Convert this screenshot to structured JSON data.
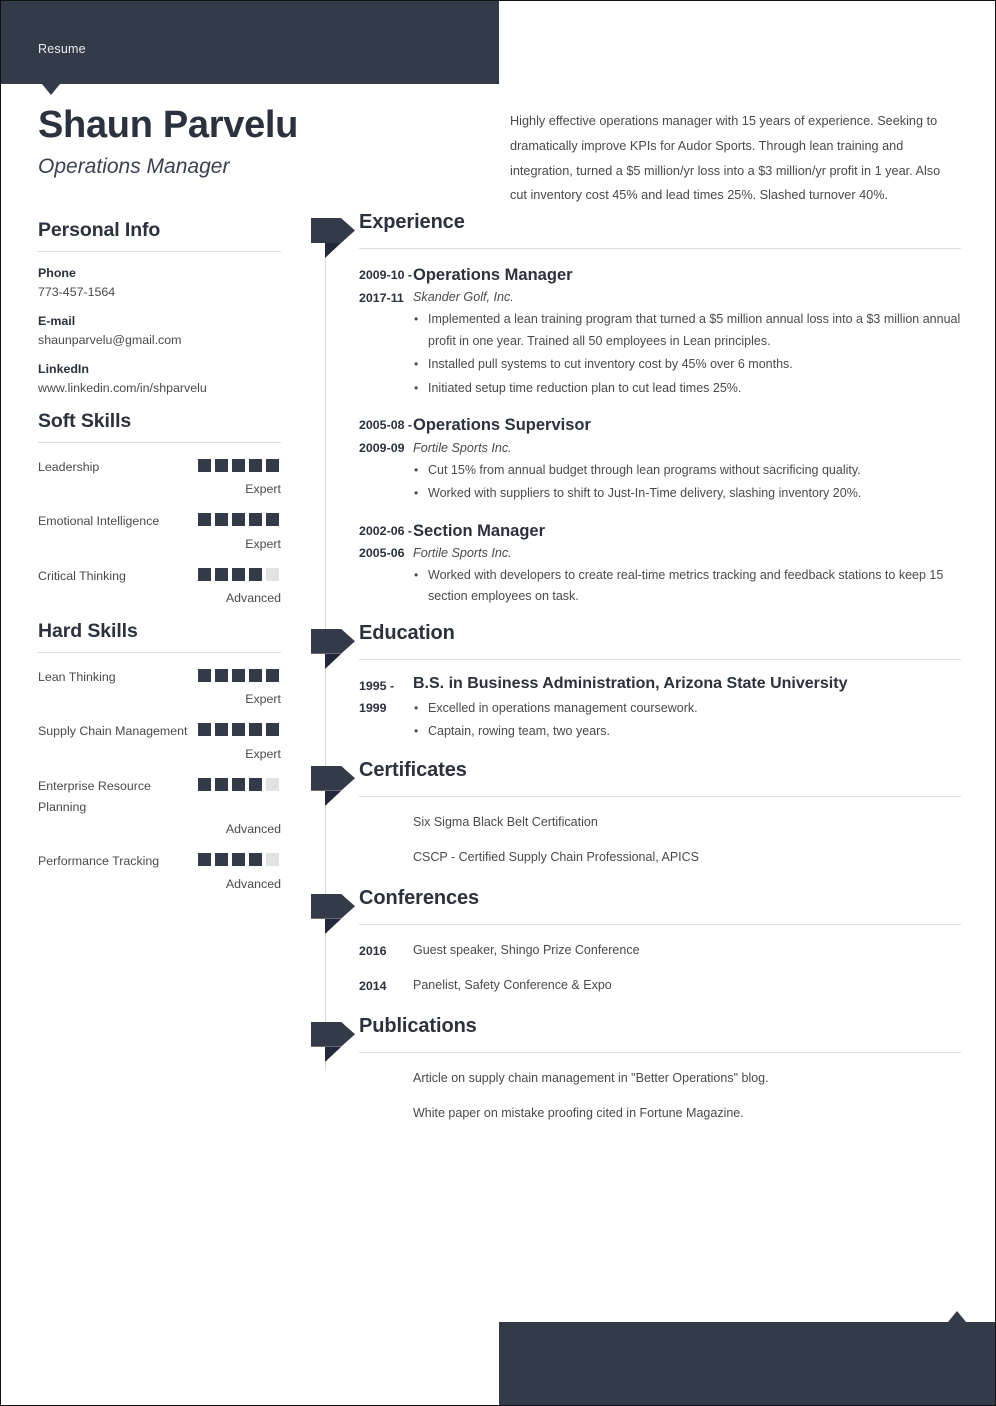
{
  "topbar": {
    "label": "Resume"
  },
  "header": {
    "name": "Shaun Parvelu",
    "title": "Operations Manager",
    "summary": "Highly effective operations manager with 15 years of experience. Seeking to dramatically improve KPIs for Audor Sports. Through lean training and integration, turned a $5 million/yr loss into a $3 million/yr profit in 1 year. Also cut inventory cost 45% and lead times 25%. Slashed turnover 40%."
  },
  "colors": {
    "dark": "#333a48",
    "rule": "#dcdcdc",
    "empty_square": "#e2e2e2"
  },
  "sidebar": {
    "personal_info": {
      "title": "Personal Info",
      "items": [
        {
          "label": "Phone",
          "value": "773-457-1564"
        },
        {
          "label": "E-mail",
          "value": "shaunparvelu@gmail.com"
        },
        {
          "label": "LinkedIn",
          "value": "www.linkedin.com/in/shparvelu"
        }
      ]
    },
    "soft_skills": {
      "title": "Soft Skills",
      "items": [
        {
          "name": "Leadership",
          "filled": 5,
          "total": 5,
          "level": "Expert"
        },
        {
          "name": "Emotional Intelligence",
          "filled": 5,
          "total": 5,
          "level": "Expert"
        },
        {
          "name": "Critical Thinking",
          "filled": 4,
          "total": 5,
          "level": "Advanced"
        }
      ]
    },
    "hard_skills": {
      "title": "Hard Skills",
      "items": [
        {
          "name": "Lean Thinking",
          "filled": 5,
          "total": 5,
          "level": "Expert"
        },
        {
          "name": "Supply Chain Management",
          "filled": 5,
          "total": 5,
          "level": "Expert"
        },
        {
          "name": "Enterprise Resource Planning",
          "filled": 4,
          "total": 5,
          "level": "Advanced"
        },
        {
          "name": "Performance Tracking",
          "filled": 4,
          "total": 5,
          "level": "Advanced"
        }
      ]
    }
  },
  "main": {
    "experience": {
      "title": "Experience",
      "entries": [
        {
          "date": "2009-10 - 2017-11",
          "role": "Operations Manager",
          "org": "Skander Golf, Inc.",
          "bullets": [
            "Implemented a lean training program that turned a $5 million annual loss into a $3 million annual profit in one year. Trained all 50 employees in Lean principles.",
            "Installed pull systems to cut inventory cost by 45% over 6 months.",
            "Initiated setup time reduction plan to cut lead times 25%."
          ]
        },
        {
          "date": "2005-08 - 2009-09",
          "role": "Operations Supervisor",
          "org": "Fortile Sports Inc.",
          "bullets": [
            "Cut 15% from annual budget through lean programs without sacrificing quality.",
            "Worked with suppliers to shift to Just-In-Time delivery, slashing inventory 20%."
          ]
        },
        {
          "date": "2002-06 - 2005-06",
          "role": "Section Manager",
          "org": "Fortile Sports Inc.",
          "bullets": [
            "Worked with developers to create real-time metrics tracking and feedback stations to keep 15 section employees on task."
          ]
        }
      ]
    },
    "education": {
      "title": "Education",
      "entries": [
        {
          "date": "1995 - 1999",
          "degree": "B.S. in Business Administration, Arizona State University",
          "bullets": [
            "Excelled in operations management coursework.",
            "Captain, rowing team, two years."
          ]
        }
      ]
    },
    "certificates": {
      "title": "Certificates",
      "items": [
        "Six Sigma Black Belt Certification",
        "CSCP - Certified Supply Chain Professional, APICS"
      ]
    },
    "conferences": {
      "title": "Conferences",
      "items": [
        {
          "year": "2016",
          "text": "Guest speaker, Shingo Prize Conference"
        },
        {
          "year": "2014",
          "text": "Panelist, Safety Conference & Expo"
        }
      ]
    },
    "publications": {
      "title": "Publications",
      "items": [
        "Article on supply chain management in \"Better Operations\" blog.",
        "White paper on mistake proofing cited in Fortune Magazine."
      ]
    }
  }
}
